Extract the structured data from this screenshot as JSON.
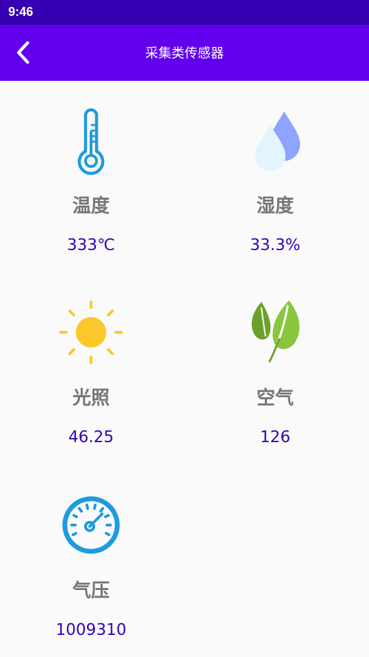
{
  "status_bar": {
    "time": "9:46"
  },
  "app_bar": {
    "back_icon": "chevron-left-icon",
    "title": "采集类传感器"
  },
  "sensors": [
    {
      "label": "温度",
      "value": "333℃",
      "icon": "thermometer-icon"
    },
    {
      "label": "湿度",
      "value": "33.3%",
      "icon": "water-drop-icon"
    },
    {
      "label": "光照",
      "value": "46.25",
      "icon": "sun-icon"
    },
    {
      "label": "空气",
      "value": "126",
      "icon": "leaf-icon"
    },
    {
      "label": "气压",
      "value": "1009310",
      "icon": "gauge-icon"
    }
  ],
  "colors": {
    "status_bar": "#3700b3",
    "app_bar": "#6200ee",
    "label": "#757575",
    "value": "#3700b3"
  }
}
